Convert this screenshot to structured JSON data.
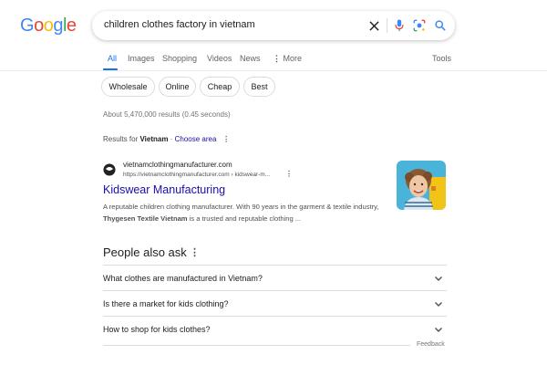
{
  "logo": {
    "letters": [
      "G",
      "o",
      "o",
      "g",
      "l",
      "e"
    ],
    "colors": [
      "#4285F4",
      "#EA4335",
      "#FBBC05",
      "#4285F4",
      "#34A853",
      "#EA4335"
    ]
  },
  "search": {
    "query": "children clothes factory in vietnam"
  },
  "icons": {
    "clear": "close-icon",
    "voice": "microphone-icon",
    "lens": "lens-icon",
    "search": "search-icon",
    "more": "more-vert-icon",
    "chevron": "chevron-down-icon"
  },
  "tabs": [
    {
      "label": "All",
      "active": true
    },
    {
      "label": "Images"
    },
    {
      "label": "Shopping"
    },
    {
      "label": "Videos"
    },
    {
      "label": "News"
    },
    {
      "label": "More"
    }
  ],
  "tools_label": "Tools",
  "chips": [
    "Wholesale",
    "Online",
    "Cheap",
    "Best"
  ],
  "result_stats": "About 5,470,000 results (0.45 seconds)",
  "region": {
    "prefix": "Results for",
    "country": "Vietnam",
    "separator": "·",
    "link": "Choose area"
  },
  "result": {
    "site_name": "vietnamclothingmanufacturer.com",
    "url": "https://vietnamclothingmanufacturer.com › kidswear-m...",
    "title": "Kidswear Manufacturing",
    "snippet_1": "A reputable children clothing manufacturer. With 90 years in the garment & textile industry,",
    "snippet_bold": "Thygesen Textile Vietnam",
    "snippet_2": "is a trusted and reputable clothing ..."
  },
  "people_also_ask": {
    "title": "People also ask",
    "questions": [
      "What clothes are manufactured in Vietnam?",
      "Is there a market for kids clothing?",
      "How to shop for kids clothes?"
    ]
  },
  "feedback_label": "Feedback",
  "colors": {
    "link": "#1a0dab",
    "accent": "#1a73e8",
    "text": "#202124",
    "muted": "#4d5156"
  }
}
